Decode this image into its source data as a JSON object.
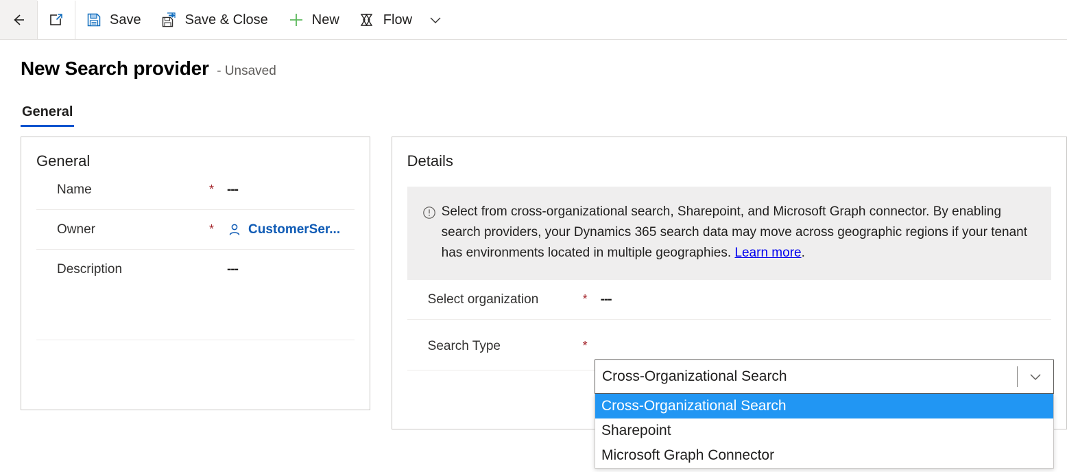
{
  "commandbar": {
    "back": {
      "label": "Back",
      "icon": "back-arrow-icon"
    },
    "popout": {
      "label": "Open in new window",
      "icon": "pop-out-icon"
    },
    "save": {
      "label": "Save",
      "icon": "save-floppy-icon"
    },
    "save_close": {
      "label": "Save & Close",
      "icon": "save-and-close-icon"
    },
    "new": {
      "label": "New",
      "icon": "plus-icon"
    },
    "flow": {
      "label": "Flow",
      "icon": "flow-icon"
    },
    "overflow": {
      "label": "More commands",
      "icon": "chevron-down-icon"
    }
  },
  "header": {
    "title": "New Search provider",
    "status": "- Unsaved"
  },
  "tabs": [
    {
      "label": "General",
      "active": true
    }
  ],
  "general_card": {
    "title": "General",
    "fields": [
      {
        "label": "Name",
        "required": "*",
        "value": "---"
      },
      {
        "label": "Owner",
        "required": "*",
        "value": "CustomerSer...",
        "icon": "person-icon"
      },
      {
        "label": "Description",
        "required": "",
        "value": "---"
      }
    ]
  },
  "details_card": {
    "title": "Details",
    "banner": {
      "icon": "info-circle-icon",
      "text_before": "Select from cross-organizational search, Sharepoint, and Microsoft Graph connector. By enabling search providers, your Dynamics 365 search data may move across geographic regions if your tenant has environments located in multiple geographies.",
      "link": "Learn more",
      "text_after": "."
    },
    "fields": [
      {
        "label": "Select organization",
        "required": "*",
        "value": "---"
      },
      {
        "label": "Search Type",
        "required": "*",
        "value": ""
      }
    ]
  },
  "search_type_combo": {
    "value": "Cross-Organizational Search",
    "caret_icon": "chevron-down-icon",
    "options": [
      {
        "label": "Cross-Organizational Search",
        "selected": true
      },
      {
        "label": "Sharepoint",
        "selected": false
      },
      {
        "label": "Microsoft Graph Connector",
        "selected": false
      }
    ]
  },
  "colors": {
    "accent": "#0b53ce",
    "link": "#0f5bb5",
    "required": "#a4262c",
    "highlight": "#2196f3",
    "banner_bg": "#efeeee",
    "new_icon": "#5cb85c"
  }
}
